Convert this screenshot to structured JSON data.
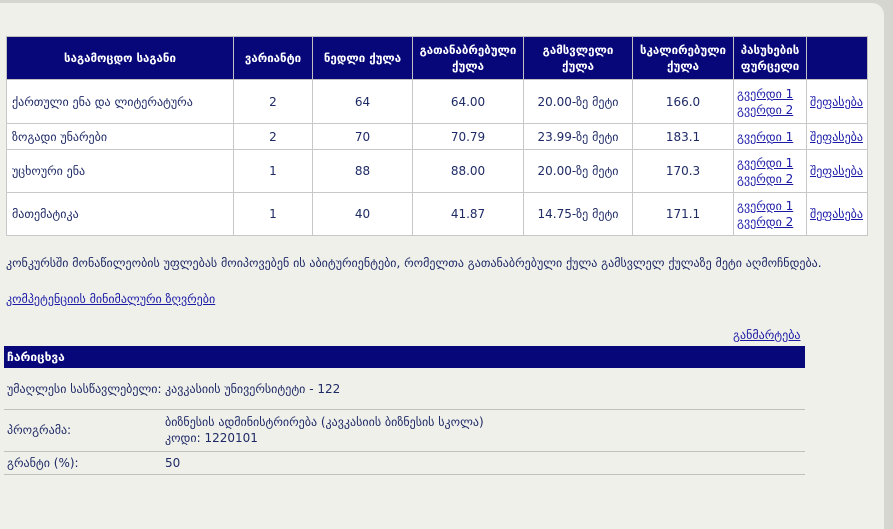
{
  "table": {
    "headers": {
      "subject": "საგამოცდო საგანი",
      "variant": "ვარიანტი",
      "raw_score": "ნედლი ქულა",
      "weighted_score": "გათანაბრებული ქულა",
      "passing_score": "გამსვლელი ქულა",
      "scaled_score": "სკალირებული ქულა",
      "answer_sheet": "პასუხების ფურცელი"
    },
    "rows": [
      {
        "subject": "ქართული ენა და ლიტერატურა",
        "variant": "2",
        "raw": "64",
        "weighted": "64.00",
        "passing": "20.00-ზე მეტი",
        "scaled": "166.0",
        "links": [
          "გვერდი 1",
          "გვერდი 2"
        ],
        "review": "შეფასება"
      },
      {
        "subject": "ზოგადი უნარები",
        "variant": "2",
        "raw": "70",
        "weighted": "70.79",
        "passing": "23.99-ზე მეტი",
        "scaled": "183.1",
        "links": [
          "გვერდი 1"
        ],
        "review": "შეფასება"
      },
      {
        "subject": "უცხოური ენა",
        "variant": "1",
        "raw": "88",
        "weighted": "88.00",
        "passing": "20.00-ზე მეტი",
        "scaled": "170.3",
        "links": [
          "გვერდი 1",
          "გვერდი 2"
        ],
        "review": "შეფასება"
      },
      {
        "subject": "მათემატიკა",
        "variant": "1",
        "raw": "40",
        "weighted": "41.87",
        "passing": "14.75-ზე მეტი",
        "scaled": "171.1",
        "links": [
          "გვერდი 1",
          "გვერდი 2"
        ],
        "review": "შეფასება"
      }
    ]
  },
  "note": "კონკურსში მონაწილეობის უფლებას მოიპოვებენ ის აბიტურიენტები, რომელთა გათანაბრებული ქულა გამსვლელ ქულაზე მეტი აღმოჩნდება.",
  "competency_link": "კომპეტენციის მინიმალური ზღვრები",
  "explanation_link": "განმარტება",
  "enrollment": {
    "title": "ჩარიცხვა",
    "university_label": "უმაღლესი სასწავლებელი:",
    "university_value": "კავკასიის უნივერსიტეტი - 122",
    "program_label": "პროგრამა:",
    "program_value": "ბიზნესის ადმინისტრირება (კავკასიის ბიზნესის სკოლა)",
    "program_code": "კოდი: 1220101",
    "grant_label": "გრანტი (%):",
    "grant_value": "50"
  }
}
